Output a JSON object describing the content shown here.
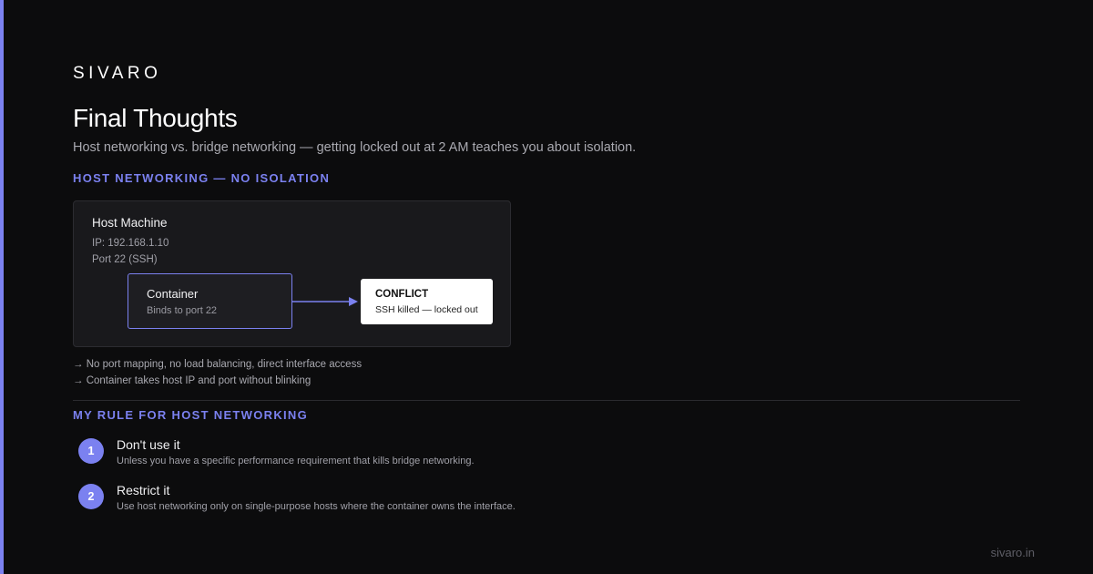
{
  "brand": "SIVARO",
  "title": "Final Thoughts",
  "subtitle": "Host networking vs. bridge networking — getting locked out at 2 AM teaches you about isolation.",
  "section1_label": "HOST NETWORKING — NO ISOLATION",
  "diagram": {
    "host_title": "Host Machine",
    "host_ip": "IP: 192.168.1.10",
    "host_port": "Port 22 (SSH)",
    "container_title": "Container",
    "container_sub": "Binds to port 22",
    "conflict_title": "CONFLICT",
    "conflict_sub": "SSH killed — locked out"
  },
  "notes": [
    "→ No port mapping, no load balancing, direct interface access",
    "→ Container takes host IP and port without blinking"
  ],
  "section2_label": "MY RULE FOR HOST NETWORKING",
  "rules": [
    {
      "num": "1",
      "title": "Don't use it",
      "desc": "Unless you have a specific performance requirement that kills bridge networking."
    },
    {
      "num": "2",
      "title": "Restrict it",
      "desc": "Use host networking only on single-purpose hosts where the container owns the interface."
    }
  ],
  "footer": "sivaro.in",
  "colors": {
    "accent": "#7b81f0",
    "background": "#0c0c0d"
  }
}
